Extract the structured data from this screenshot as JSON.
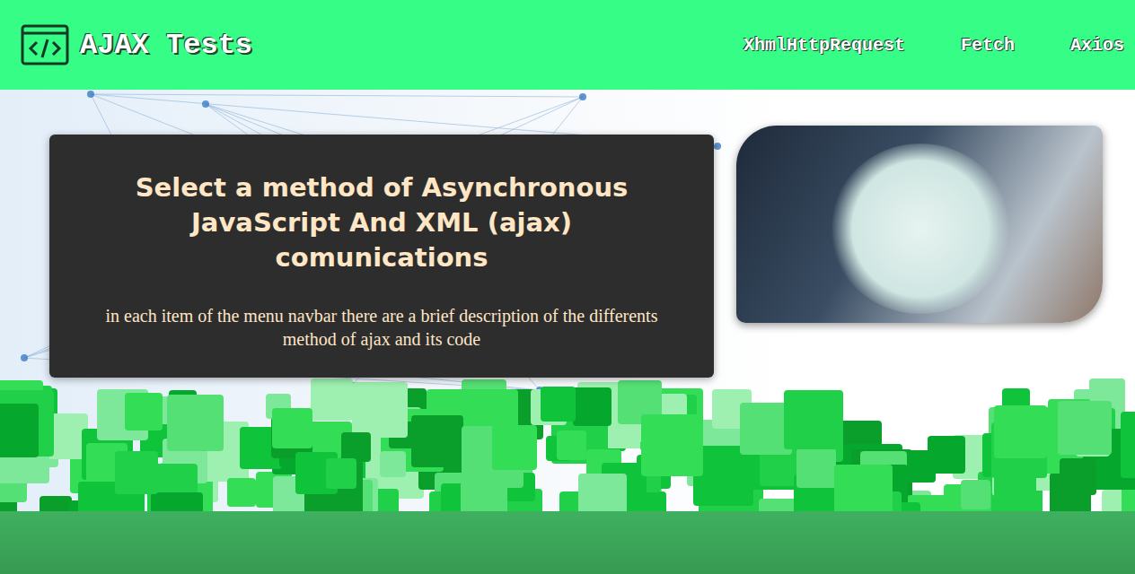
{
  "header": {
    "logo_text": "AJAX Tests"
  },
  "nav": {
    "items": [
      {
        "label": "XhmlHttpRequest"
      },
      {
        "label": "Fetch"
      },
      {
        "label": "Axios"
      }
    ]
  },
  "hero": {
    "title": "Select a method of Asynchronous JavaScript And XML (ajax) comunications",
    "description": "in each item of the menu navbar there are a brief description of the differents method of ajax and its code"
  }
}
